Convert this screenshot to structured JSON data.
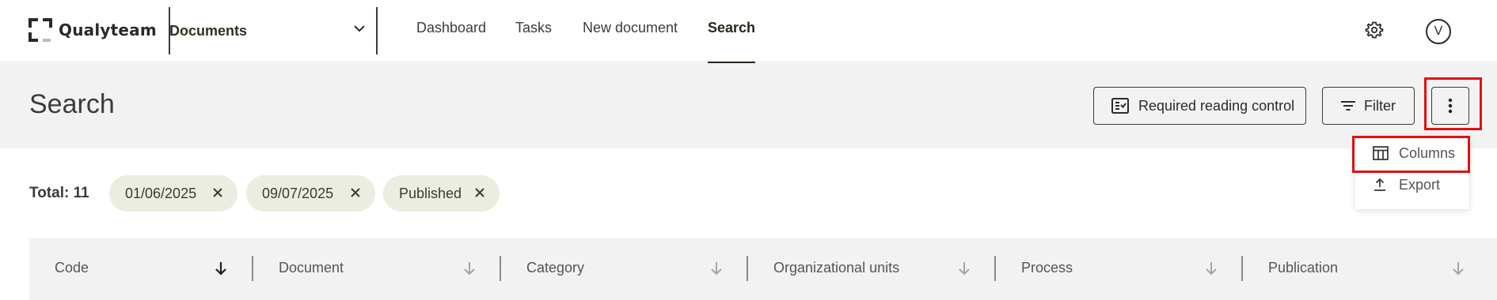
{
  "app": {
    "logo_text": "Qualyteam"
  },
  "module_selector": {
    "label": "Documents"
  },
  "nav": {
    "items": [
      {
        "label": "Dashboard",
        "active": false
      },
      {
        "label": "Tasks",
        "active": false
      },
      {
        "label": "New document",
        "active": false
      },
      {
        "label": "Search",
        "active": true
      }
    ]
  },
  "user": {
    "initial": "V"
  },
  "page": {
    "title": "Search"
  },
  "toolbar": {
    "required_reading_label": "Required reading control",
    "filter_label": "Filter"
  },
  "more_menu": {
    "items": [
      {
        "label": "Columns",
        "icon": "columns-icon",
        "highlighted": true
      },
      {
        "label": "Export",
        "icon": "export-icon",
        "highlighted": false
      }
    ]
  },
  "results": {
    "total_label": "Total: 11",
    "chips": [
      "01/06/2025",
      "09/07/2025",
      "Published"
    ]
  },
  "table": {
    "columns": [
      {
        "label": "Code",
        "sorted": true
      },
      {
        "label": "Document",
        "sorted": false
      },
      {
        "label": "Category",
        "sorted": false
      },
      {
        "label": "Organizational units",
        "sorted": false
      },
      {
        "label": "Process",
        "sorted": false
      },
      {
        "label": "Publication",
        "sorted": false
      }
    ]
  },
  "colors": {
    "highlight": "#e01010",
    "chip_bg": "#ebede0",
    "header_band": "#f2f2f2",
    "nav_active": "#23281c"
  }
}
